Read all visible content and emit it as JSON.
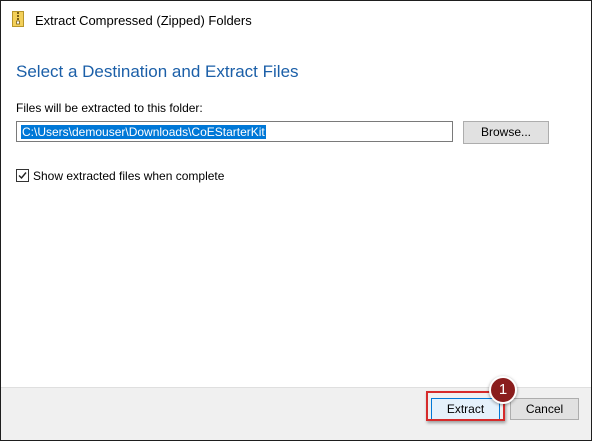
{
  "window": {
    "title": "Extract Compressed (Zipped) Folders",
    "icon": "zip-folder-icon"
  },
  "main": {
    "heading": "Select a Destination and Extract Files",
    "folder_label": "Files will be extracted to this folder:",
    "path_value": "C:\\Users\\demouser\\Downloads\\CoEStarterKit",
    "browse_label": "Browse...",
    "show_files_checked": true,
    "show_files_label": "Show extracted files when complete"
  },
  "footer": {
    "extract_label": "Extract",
    "cancel_label": "Cancel"
  },
  "annotation": {
    "step_number": "1",
    "color": "#d62b2b",
    "badge_color": "#8a1d1d"
  },
  "colors": {
    "heading": "#1b5fa8",
    "selection": "#0078d7",
    "footer_bg": "#f0f0f0"
  }
}
